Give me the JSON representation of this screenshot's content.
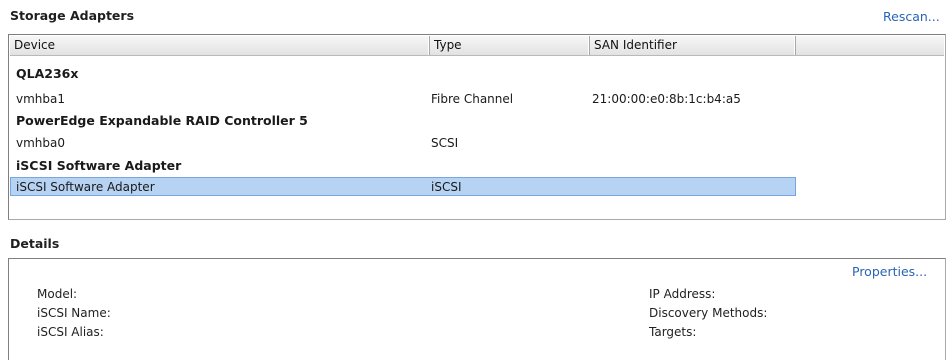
{
  "storage_adapters": {
    "title": "Storage Adapters",
    "rescan_label": "Rescan...",
    "columns": [
      "Device",
      "Type",
      "SAN Identifier"
    ],
    "groups": [
      {
        "name": "QLA236x",
        "items": [
          {
            "device": "vmhba1",
            "type": "Fibre Channel",
            "san": "21:00:00:e0:8b:1c:b4:a5",
            "selected": false
          }
        ]
      },
      {
        "name": "PowerEdge Expandable RAID Controller 5",
        "items": [
          {
            "device": "vmhba0",
            "type": "SCSI",
            "san": "",
            "selected": false
          }
        ]
      },
      {
        "name": "iSCSI Software Adapter",
        "items": [
          {
            "device": "iSCSI Software Adapter",
            "type": "iSCSI",
            "san": "",
            "selected": true
          }
        ]
      }
    ]
  },
  "details": {
    "title": "Details",
    "properties_label": "Properties...",
    "left_labels": [
      "Model:",
      "iSCSI Name:",
      "iSCSI Alias:"
    ],
    "right_labels": [
      "IP Address:",
      "Discovery Methods:",
      "Targets:"
    ]
  },
  "colors": {
    "link": "#2a64b4",
    "selection": "#b7d3f3",
    "selection_border": "#7aa6dc"
  }
}
